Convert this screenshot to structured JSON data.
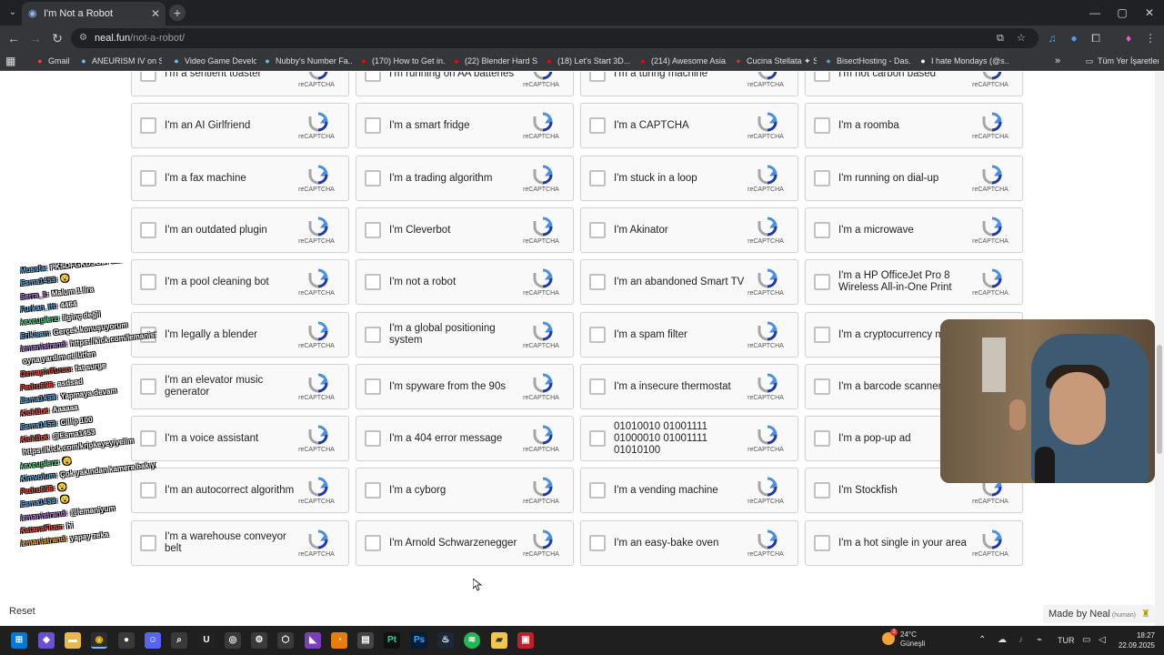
{
  "browser": {
    "tab_title": "I'm Not a Robot",
    "url_host": "neal.fun",
    "url_path": "/not-a-robot/",
    "bookmarks": [
      {
        "label": "Gmail",
        "icon": "gmail-icon",
        "color": "#ea4335"
      },
      {
        "label": "ANEURISM IV on St...",
        "icon": "steam-icon",
        "color": "#66c0f4"
      },
      {
        "label": "Video Game Develo...",
        "icon": "steam-icon",
        "color": "#66c0f4"
      },
      {
        "label": "Nubby's Number Fa...",
        "icon": "steam-icon",
        "color": "#66c0f4"
      },
      {
        "label": "(170) How to Get in...",
        "icon": "youtube-icon",
        "color": "#ff0000"
      },
      {
        "label": "(22) Blender Hard S...",
        "icon": "youtube-icon",
        "color": "#ff0000"
      },
      {
        "label": "(18) Let's Start 3D...",
        "icon": "youtube-icon",
        "color": "#ff0000"
      },
      {
        "label": "(214) Awesome Asia...",
        "icon": "youtube-icon",
        "color": "#ff0000"
      },
      {
        "label": "Cucina Stellata ✦ St...",
        "icon": "site-icon",
        "color": "#c0392b"
      },
      {
        "label": "BisectHosting - Das...",
        "icon": "globe-icon",
        "color": "#4aa3df"
      },
      {
        "label": "I hate Mondays (@s...",
        "icon": "x-icon",
        "color": "#ffffff"
      }
    ],
    "bookmarks_folder": "Tüm Yer İşaretleri"
  },
  "captchas": [
    [
      "I'm a sentient toaster",
      "I'm running on AA batteries",
      "I'm a turing machine",
      "I'm not carbon based"
    ],
    [
      "I'm an AI Girlfriend",
      "I'm a smart fridge",
      "I'm a CAPTCHA",
      "I'm a roomba"
    ],
    [
      "I'm a fax machine",
      "I'm a trading algorithm",
      "I'm stuck in a loop",
      "I'm running on dial-up"
    ],
    [
      "I'm an outdated plugin",
      "I'm Cleverbot",
      "I'm Akinator",
      "I'm a microwave"
    ],
    [
      "I'm a pool cleaning bot",
      "I'm not a robot",
      "I'm an abandoned Smart TV",
      "I'm a HP OfficeJet Pro 8 Wireless All-in-One Print"
    ],
    [
      "I'm legally a blender",
      "I'm a global positioning system",
      "I'm a spam filter",
      "I'm a cryptocurrency mi"
    ],
    [
      "I'm an elevator music generator",
      "I'm spyware from the 90s",
      "I'm a insecure thermostat",
      "I'm a barcode scanner"
    ],
    [
      "I'm a voice assistant",
      "I'm a 404 error message",
      "01010010 01001111 01000010 01001111 01010100",
      "I'm a pop-up ad"
    ],
    [
      "I'm an autocorrect algorithm",
      "I'm a cyborg",
      "I'm a vending machine",
      "I'm Stockfish"
    ],
    [
      "I'm a warehouse conveyor belt",
      "I'm Arnold Schwarzenegger",
      "I'm an easy-bake oven",
      "I'm a hot single in your area"
    ]
  ],
  "recaptcha_label": "reCAPTCHA",
  "reset_label": "Reset",
  "made_by": "Made by Neal",
  "made_by_sub": "(human)",
  "chat": [
    {
      "name": "Mossfa:",
      "msg": "PKSDFGKDSGDFGSDF",
      "color": "#5dade2"
    },
    {
      "name": "Esma1453:",
      "msg": "😮",
      "color": "#5dade2"
    },
    {
      "name": "Serra_1:",
      "msg": "Malum 1 lira",
      "color": "#b57edc"
    },
    {
      "name": "Furkan_ttt:",
      "msg": "4464",
      "color": "#5dade2"
    },
    {
      "name": "kexcuplerz:",
      "msg": "ilginç değil",
      "color": "#58d68d"
    },
    {
      "name": "Erikisan:",
      "msg": "Gerçek konuşuyorum",
      "color": "#5dade2"
    },
    {
      "name": "lemanistrand:",
      "msg": "https://kick.com/lemanistrand",
      "color": "#b57edc"
    },
    {
      "name": "",
      "msg": "oyna yardım et lütfen",
      "color": "#ffffff"
    },
    {
      "name": "OzmapinTurco:",
      "msg": "fat surge",
      "color": "#e74c3c"
    },
    {
      "name": "Pedro696:",
      "msg": "asdsad",
      "color": "#e74c3c"
    },
    {
      "name": "Esma1453:",
      "msg": "Yapmaya devam",
      "color": "#5dade2"
    },
    {
      "name": "KickBot:",
      "msg": "Aaaaaa",
      "color": "#e74c3c"
    },
    {
      "name": "Esma1453:",
      "msg": "Cillip 100",
      "color": "#5dade2"
    },
    {
      "name": "KickBot:",
      "msg": "@Esma1453",
      "color": "#e74c3c"
    },
    {
      "name": "",
      "msg": "https://kick.com/kripkeyeyiyelim",
      "color": "#ffffff"
    },
    {
      "name": "kexcuplerz:",
      "msg": "😮",
      "color": "#58d68d"
    },
    {
      "name": "Kimvolum:",
      "msg": "Çok yakından kamera bakıyorum",
      "color": "#5dade2"
    },
    {
      "name": "Pedro696:",
      "msg": "😮",
      "color": "#e74c3c"
    },
    {
      "name": "Esma1453:",
      "msg": "😮",
      "color": "#5dade2"
    },
    {
      "name": "lemanistrand:",
      "msg": "@lemaniyum",
      "color": "#b57edc"
    },
    {
      "name": "KatanaFirss:",
      "msg": "hi",
      "color": "#e74c3c"
    },
    {
      "name": "lemanistrand:",
      "msg": "yapay zeka",
      "color": "#f5b041"
    }
  ],
  "taskbar": {
    "weather_temp": "24°C",
    "weather_desc": "Güneşli",
    "weather_badge": "3",
    "language": "TUR",
    "time": "18:27",
    "date": "22.09.2025"
  }
}
